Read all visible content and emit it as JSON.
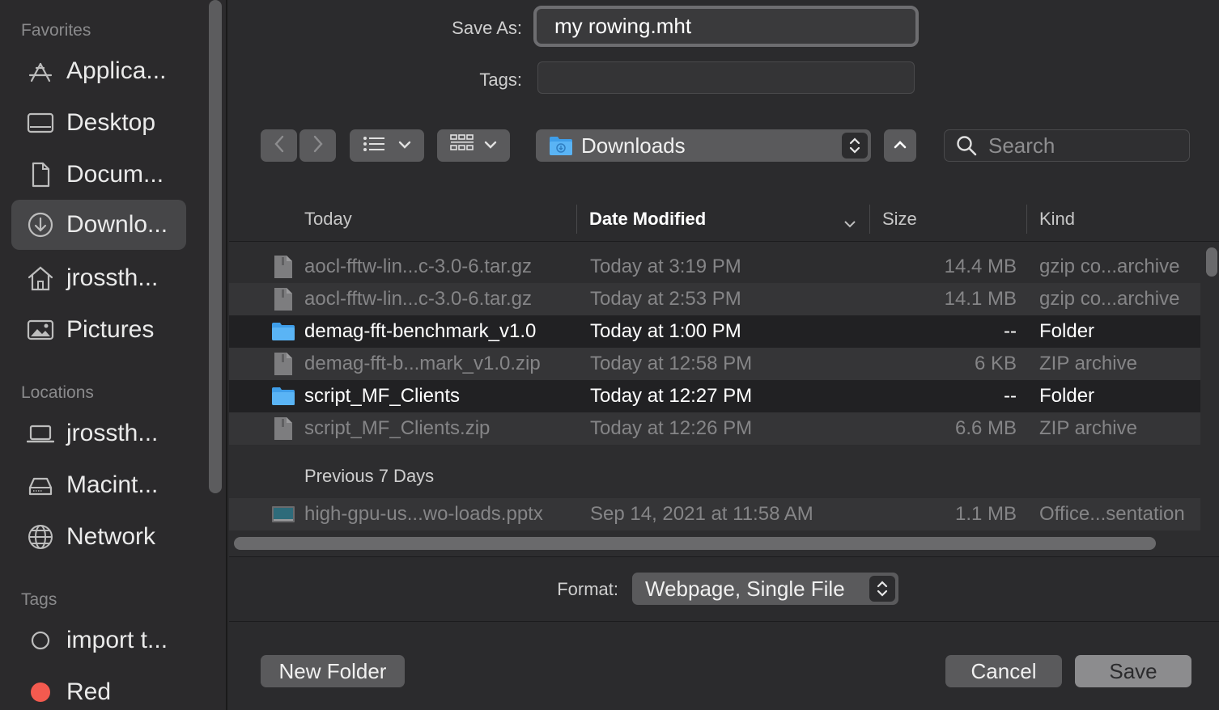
{
  "sidebar": {
    "sections": {
      "favorites": "Favorites",
      "locations": "Locations",
      "tags": "Tags"
    },
    "favorites": [
      {
        "label": "Applica...",
        "icon": "applications-icon"
      },
      {
        "label": "Desktop",
        "icon": "desktop-icon"
      },
      {
        "label": "Docum...",
        "icon": "document-icon"
      },
      {
        "label": "Downlo...",
        "icon": "downloads-icon",
        "selected": true
      },
      {
        "label": "jrossth...",
        "icon": "home-icon"
      },
      {
        "label": "Pictures",
        "icon": "pictures-icon"
      }
    ],
    "locations": [
      {
        "label": "jrossth...",
        "icon": "laptop-icon"
      },
      {
        "label": "Macint...",
        "icon": "harddrive-icon"
      },
      {
        "label": "Network",
        "icon": "network-icon"
      }
    ],
    "tags": [
      {
        "label": "import t...",
        "color": "none"
      },
      {
        "label": "Red",
        "color": "#f35a4f"
      }
    ]
  },
  "form": {
    "save_as_label": "Save As:",
    "save_as_value": "my rowing.mht",
    "tags_label": "Tags:"
  },
  "toolbar": {
    "location": "Downloads",
    "search_placeholder": "Search"
  },
  "table": {
    "columns": {
      "name": "Today",
      "date": "Date Modified",
      "size": "Size",
      "kind": "Kind"
    },
    "groups": [
      {
        "title": "Today",
        "rows": [
          {
            "name": "aocl-fftw-lin...c-3.0-6.tar.gz",
            "date": "Today at 3:19 PM",
            "size": "14.4 MB",
            "kind": "gzip co...archive",
            "type": "file",
            "enabled": false
          },
          {
            "name": "aocl-fftw-lin...c-3.0-6.tar.gz",
            "date": "Today at 2:53 PM",
            "size": "14.1 MB",
            "kind": "gzip co...archive",
            "type": "file",
            "enabled": false
          },
          {
            "name": "demag-fft-benchmark_v1.0",
            "date": "Today at 1:00 PM",
            "size": "--",
            "kind": "Folder",
            "type": "folder",
            "enabled": true
          },
          {
            "name": "demag-fft-b...mark_v1.0.zip",
            "date": "Today at 12:58 PM",
            "size": "6 KB",
            "kind": "ZIP archive",
            "type": "file",
            "enabled": false
          },
          {
            "name": "script_MF_Clients",
            "date": "Today at 12:27 PM",
            "size": "--",
            "kind": "Folder",
            "type": "folder",
            "enabled": true
          },
          {
            "name": "script_MF_Clients.zip",
            "date": "Today at 12:26 PM",
            "size": "6.6 MB",
            "kind": "ZIP archive",
            "type": "file",
            "enabled": false
          }
        ]
      },
      {
        "title": "Previous 7 Days",
        "rows": [
          {
            "name": "high-gpu-us...wo-loads.pptx",
            "date": "Sep 14, 2021 at 11:58 AM",
            "size": "1.1 MB",
            "kind": "Office...sentation",
            "type": "pptx",
            "enabled": false
          }
        ]
      }
    ]
  },
  "format": {
    "label": "Format:",
    "value": "Webpage, Single File"
  },
  "buttons": {
    "new_folder": "New Folder",
    "cancel": "Cancel",
    "save": "Save"
  }
}
